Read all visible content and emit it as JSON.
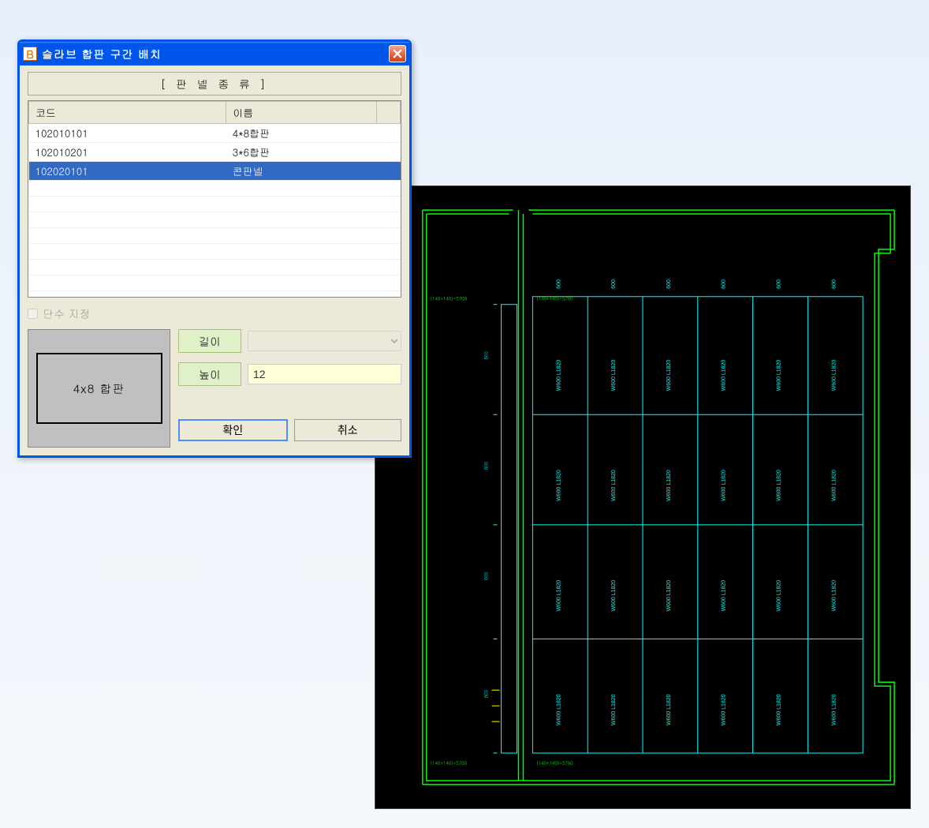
{
  "dialog": {
    "title": "슬라브 합판 구간 배치",
    "panel_type_label": "[ 판 넬    종 류 ]",
    "columns": {
      "code": "코드",
      "name": "이름"
    },
    "rows": [
      {
        "code": "102010101",
        "name": "4*8합판",
        "selected": false
      },
      {
        "code": "102010201",
        "name": "3*6합판",
        "selected": false
      },
      {
        "code": "102020101",
        "name": "콘판넬",
        "selected": true
      }
    ],
    "checkbox_label": "단수 지정",
    "preview_label": "4x8 합판",
    "length_label": "길이",
    "height_label": "높이",
    "height_value": "12",
    "ok_label": "확인",
    "cancel_label": "취소"
  },
  "cad": {
    "panel_label": "W600 L1820",
    "dim_short": "600",
    "top_note": "(140+140)=5700",
    "bottom_note": "(140+140)=5700"
  }
}
